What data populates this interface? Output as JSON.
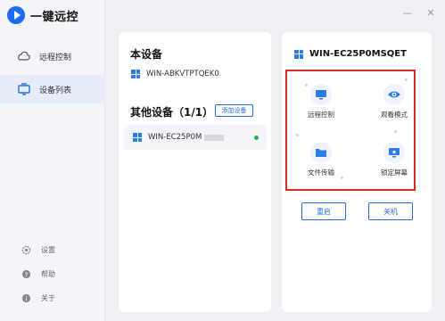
{
  "app": {
    "title": "一键远控"
  },
  "window": {
    "minimize": "—",
    "close": "✕"
  },
  "sidebar": {
    "items": [
      {
        "label": "远程控制",
        "icon": "cloud-icon",
        "active": false
      },
      {
        "label": "设备列表",
        "icon": "device-list-icon",
        "active": true
      }
    ],
    "bottom": [
      {
        "label": "设置",
        "icon": "gear-icon"
      },
      {
        "label": "帮助",
        "icon": "help-icon"
      },
      {
        "label": "关于",
        "icon": "info-icon"
      }
    ]
  },
  "this_device": {
    "title": "本设备",
    "name": "WIN-ABKVTPTQEK0"
  },
  "other_devices": {
    "title": "其他设备（1/1）",
    "add_label": "添加设备",
    "items": [
      {
        "name": "WIN-EC25P0M",
        "status": "online"
      }
    ]
  },
  "device_detail": {
    "name": "WIN-EC25P0MSQET",
    "actions": [
      {
        "label": "远程控制",
        "icon": "monitor-icon"
      },
      {
        "label": "观看模式",
        "icon": "eye-icon"
      },
      {
        "label": "文件传输",
        "icon": "folder-icon"
      },
      {
        "label": "锁定屏幕",
        "icon": "lock-screen-icon"
      }
    ],
    "buttons": {
      "restart": "重启",
      "shutdown": "关机"
    }
  },
  "colors": {
    "accent": "#2a6be0",
    "highlight_border": "#d42a2a",
    "online": "#23b54a"
  }
}
